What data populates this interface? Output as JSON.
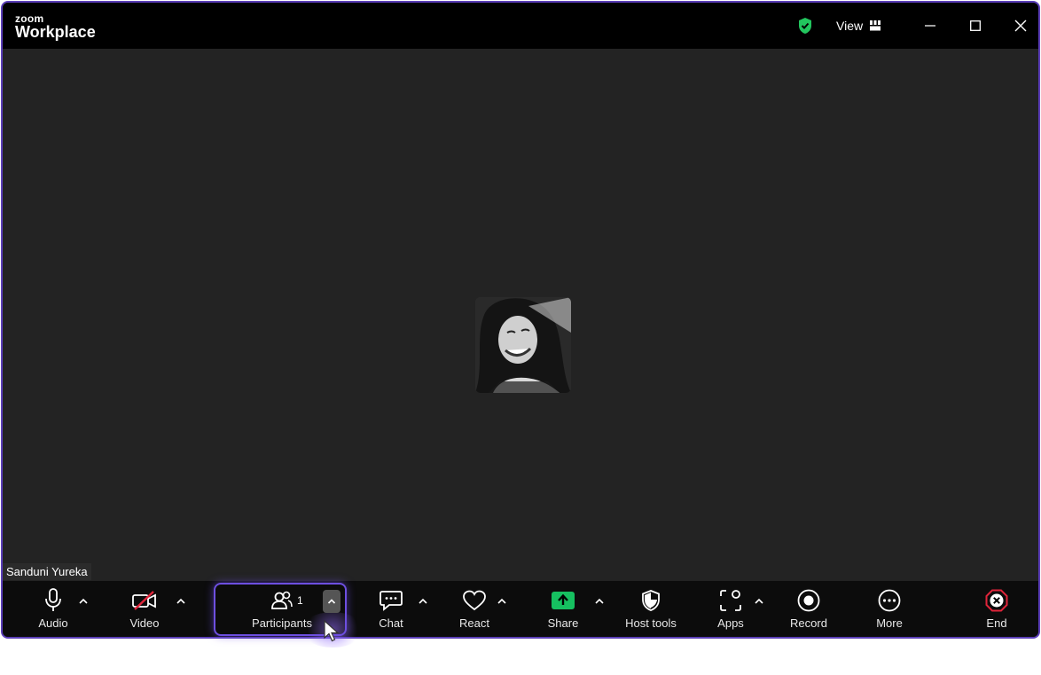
{
  "app": {
    "brand_top": "zoom",
    "brand_bottom": "Workplace"
  },
  "titlebar": {
    "view_label": "View"
  },
  "meeting": {
    "participant_name": "Sanduni Yureka"
  },
  "toolbar": {
    "audio": "Audio",
    "video": "Video",
    "participants": "Participants",
    "participants_count": "1",
    "chat": "Chat",
    "react": "React",
    "share": "Share",
    "host_tools": "Host tools",
    "apps": "Apps",
    "record": "Record",
    "more": "More",
    "end": "End"
  },
  "colors": {
    "window_border": "#5b3fb8",
    "secure_green": "#22c55e",
    "share_green": "#16c060",
    "end_red": "#e0243a",
    "stage_bg": "#232323",
    "toolbar_bg": "#0c0c0c"
  },
  "icons": [
    "secure-shield-icon",
    "gallery-view-icon",
    "minimize-icon",
    "maximize-icon",
    "close-icon",
    "microphone-icon",
    "video-off-icon",
    "participants-icon",
    "chat-icon",
    "heart-icon",
    "share-arrow-icon",
    "host-shield-icon",
    "apps-icon",
    "record-icon",
    "more-icon",
    "end-icon",
    "cursor-icon"
  ]
}
